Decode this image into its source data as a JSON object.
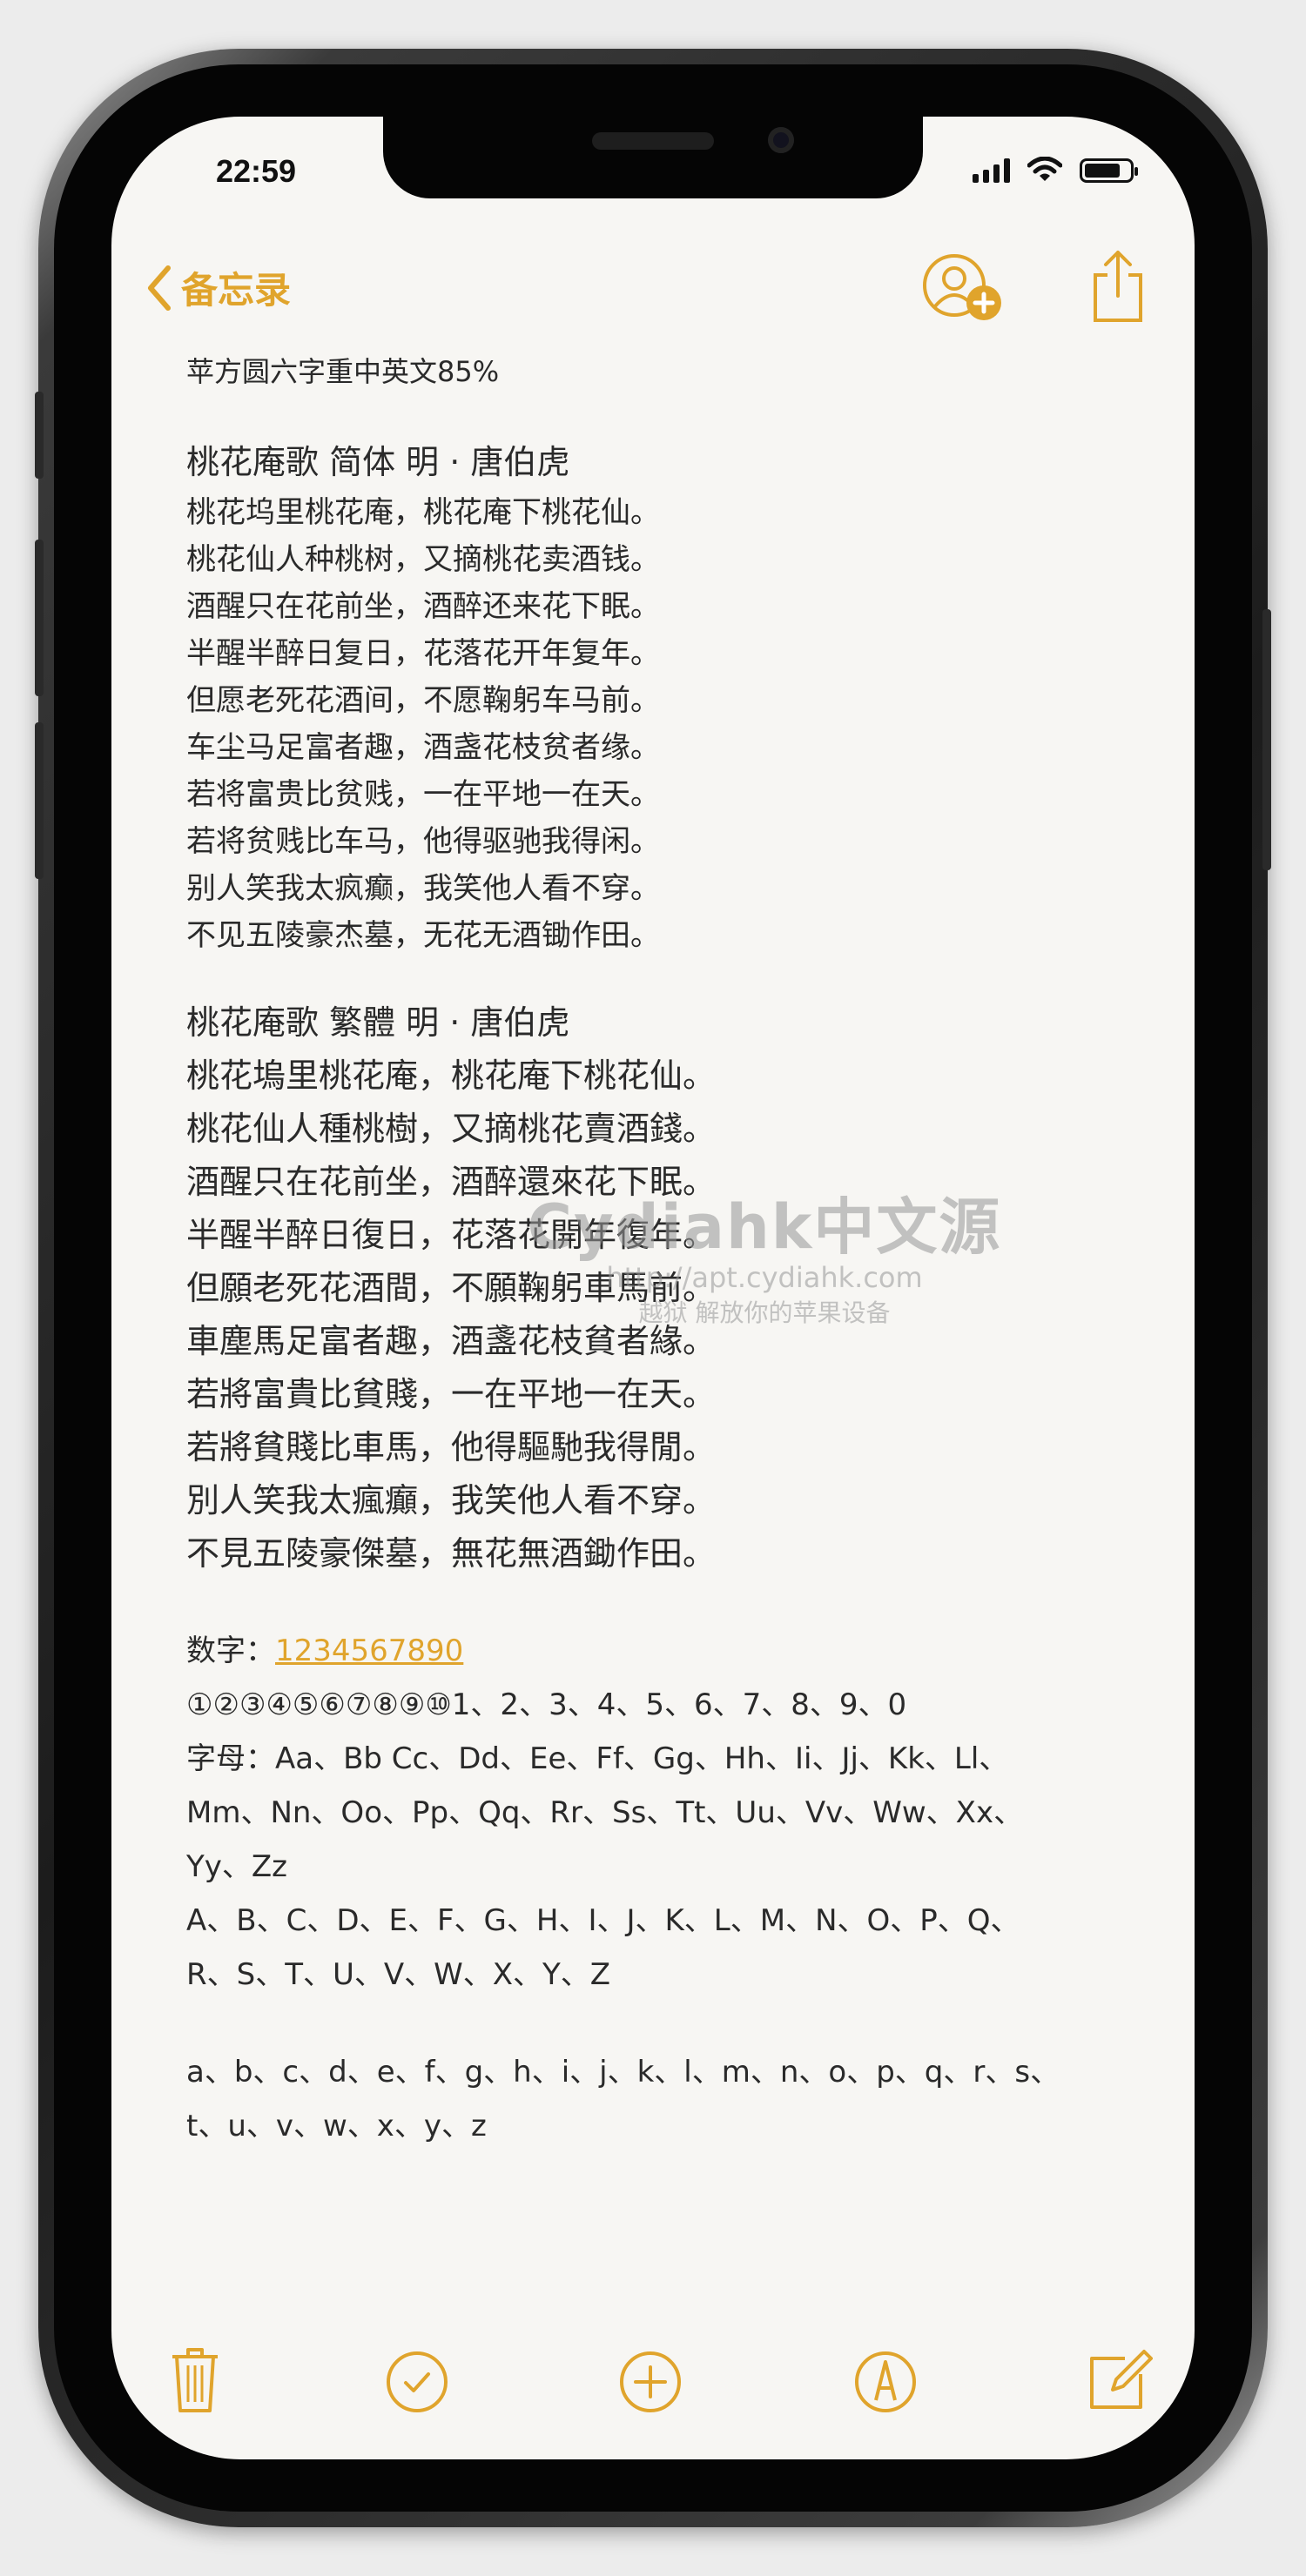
{
  "status_bar": {
    "time": "22:59"
  },
  "nav": {
    "back_label": "备忘录"
  },
  "note": {
    "heading": "苹方圆六字重中英文85%",
    "simplified": {
      "title": "桃花庵歌  简体   明 · 唐伯虎",
      "lines": [
        "桃花坞里桃花庵，桃花庵下桃花仙。",
        "桃花仙人种桃树，又摘桃花卖酒钱。",
        "酒醒只在花前坐，酒醉还来花下眠。",
        "半醒半醉日复日，花落花开年复年。",
        "但愿老死花酒间，不愿鞠躬车马前。",
        "车尘马足富者趣，酒盏花枝贫者缘。",
        "若将富贵比贫贱，一在平地一在天。",
        "若将贫贱比车马，他得驱驰我得闲。",
        "别人笑我太疯癫，我笑他人看不穿。",
        "不见五陵豪杰墓，无花无酒锄作田。"
      ]
    },
    "traditional": {
      "title": "桃花庵歌  繁體     明 · 唐伯虎",
      "lines": [
        "桃花塢里桃花庵，桃花庵下桃花仙。",
        "桃花仙人種桃樹，又摘桃花賣酒錢。",
        "酒醒只在花前坐，酒醉還來花下眠。",
        "半醒半醉日復日，花落花開年復年。",
        "但願老死花酒間，不願鞠躬車馬前。",
        "車塵馬足富者趣，酒盞花枝貧者緣。",
        "若將富貴比貧賤，一在平地一在天。",
        "若將貧賤比車馬，他得驅馳我得閒。",
        "別人笑我太瘋癲，我笑他人看不穿。",
        "不見五陵豪傑墓，無花無酒鋤作田。"
      ]
    },
    "numbers": {
      "label": "数字：",
      "value": "1234567890",
      "circled": "①②③④⑤⑥⑦⑧⑨⑩1、2、3、4、5、6、7、8、9、0"
    },
    "letters": [
      "字母：Aa、Bb Cc、Dd、Ee、Ff、Gg、Hh、Ii、Jj、Kk、Ll、",
      "Mm、Nn、Oo、Pp、Qq、Rr、Ss、Tt、Uu、Vv、Ww、Xx、",
      "Yy、Zz",
      "A、B、C、D、E、F、G、H、I、J、K、L、M、N、O、P、Q、",
      "R、S、T、U、V、W、X、Y、Z"
    ],
    "lowercase": [
      "a、b、c、d、e、f、g、h、i、j、k、l、m、n、o、p、q、r、s、",
      "t、u、v、w、x、y、z"
    ]
  },
  "watermark": {
    "title": "Cydiahk中文源",
    "url": "http://apt.cydiahk.com",
    "slogan": "越狱 解放你的苹果设备"
  },
  "colors": {
    "accent": "#e0a42c",
    "paper": "#f7f6f3",
    "text": "#2a2a2a"
  },
  "icons": {
    "back": "chevron-left-icon",
    "add_people": "add-person-icon",
    "share": "share-icon",
    "trash": "trash-icon",
    "checklist": "checkmark-circle-icon",
    "add": "plus-circle-icon",
    "markup": "markup-pen-icon",
    "compose": "compose-icon"
  }
}
